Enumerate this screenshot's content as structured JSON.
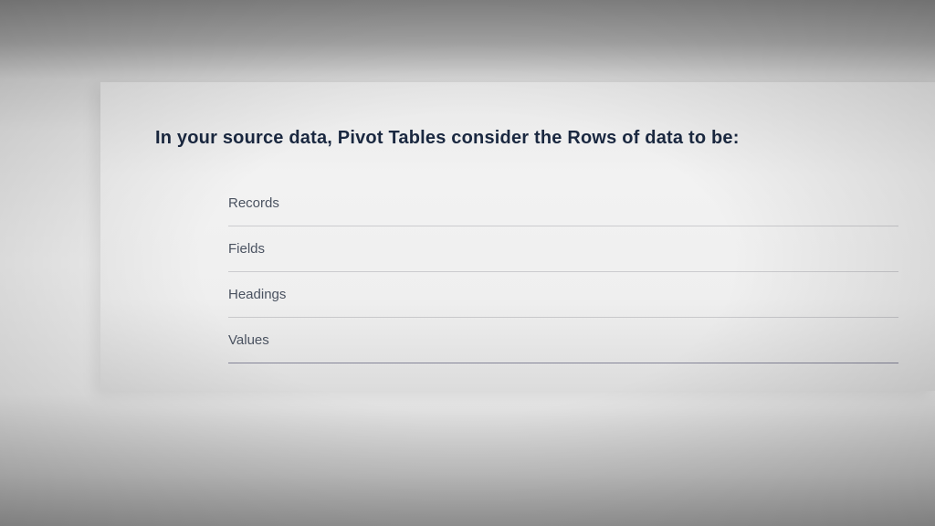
{
  "question": "In your source data, Pivot Tables consider the Rows of data to be:",
  "options": [
    "Records",
    "Fields",
    "Headings",
    "Values"
  ]
}
